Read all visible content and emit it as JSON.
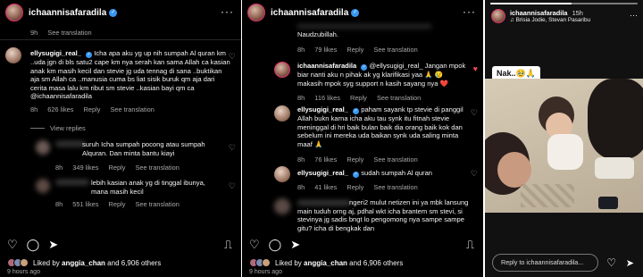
{
  "left_panel": {
    "username": "ichaannisafaradila",
    "top_meta": {
      "time": "9h",
      "translate": "See translation"
    },
    "main_comment": {
      "username": "ellysugigi_real_",
      "text": "Icha apa aku yg up nih sumpah Al quran km ..uda jgn di bls satu2 cape km nya serah kan sama Allah ca kasian anak km masih kecil dan stevie jg uda tennag di sana ..buktikan aja sm Allah ca ..manusia cuma bs liat sisik buruk qm aja dari cerita masa lalu km ribut sm stevie ..kasian bayi qm ca @ichaannisafaradila",
      "time": "8h",
      "likes": "626 likes",
      "reply": "Reply",
      "translate": "See translation"
    },
    "view_replies": "View replies",
    "blurred_replies": [
      {
        "text": "suruh Icha sumpah pocong atau sumpah Alquran. Dan minta bantu kiayi",
        "time": "8h",
        "likes": "349 likes",
        "reply": "Reply",
        "translate": "See translation"
      },
      {
        "text": "lebih kasian anak yg di tinggal ibunya, mana masih kecil",
        "time": "8h",
        "likes": "551 likes",
        "reply": "Reply",
        "translate": "See translation"
      }
    ],
    "liked_by": {
      "prefix": "Liked by",
      "user": "anggia_chan",
      "suffix": "and 6,906 others"
    },
    "ago": "9 hours ago"
  },
  "middle_panel": {
    "username": "ichaannisafaradila",
    "top_comment": {
      "text": "Naudzubillah.",
      "time": "8h",
      "likes": "79 likes",
      "reply": "Reply",
      "translate": "See translation"
    },
    "comments": [
      {
        "username": "ichaannisafaradila",
        "text": "@ellysugigi_real_ Jangan mpok biar nanti aku n pihak ak yg klarifikasi yaa 🙏 😢 makasih mpok syg support n kasih sayang nya ❤️",
        "time": "8h",
        "likes": "116 likes",
        "reply": "Reply",
        "translate": "See translation"
      },
      {
        "username": "ellysugigi_real_",
        "text": "paham sayank tp stevie di panggil Allah bukn karna icha aku tau synk itu fitnah stevie meninggal di hri baik bulan baik dia orang baik kok dan sebelum ini mereka uda baikan synk uda saling minta maaf 🙏",
        "time": "8h",
        "likes": "76 likes",
        "reply": "Reply",
        "translate": "See translation"
      },
      {
        "username": "ellysugigi_real_",
        "text": "sudah sumpah Al quran",
        "time": "8h",
        "likes": "41 likes",
        "reply": "Reply",
        "translate": "See translation"
      }
    ],
    "blurred_comment": {
      "text": "ngeri2 mulut netizen ini ya mbk lansung main tuduh orng aj, pdhal wkt icha brantem sm stevi, si stevinya jg sadis bngt lo pengomong nya sampe sampe gitu? icha di bengkak dan"
    },
    "liked_by": {
      "prefix": "Liked by",
      "user": "anggia_chan",
      "suffix": "and 6,906 others"
    },
    "ago": "9 hours ago"
  },
  "right_panel": {
    "username": "ichaannisafaradila",
    "time": "15h",
    "music": "Brisia Jodie, Stevan Pasaribu",
    "sticker": "Nak..🥹🙏",
    "reply_placeholder": "Reply to ichaannisafaradila...",
    "progress": 0.55
  },
  "colors": {
    "background": "#000000",
    "muted": "#a8a8a8",
    "verified": "#3897f0",
    "heart_red": "#ed4956"
  }
}
